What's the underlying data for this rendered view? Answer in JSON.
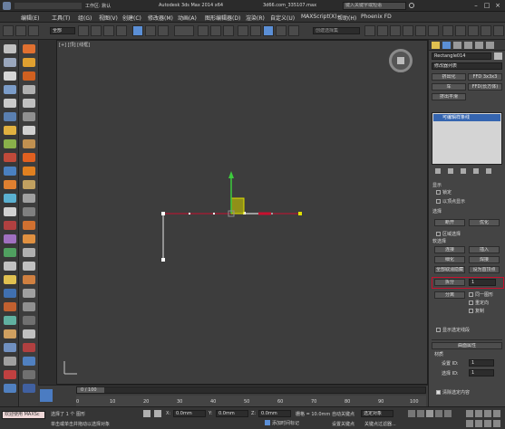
{
  "title": {
    "workspace_label": "工作区: 默认",
    "app_title": "Autodesk 3ds Max  2014 x64",
    "file_name": "3d66.com_335107.max",
    "search_placeholder": "键入关键字或短语"
  },
  "menu": [
    "编辑(E)",
    "工具(T)",
    "组(G)",
    "视图(V)",
    "创建(C)",
    "修改器(M)",
    "动画(A)",
    "图形编辑器(D)",
    "渲染(R)",
    "自定义(U)",
    "MAXScript(X)",
    "帮助(H)",
    "Phoenix FD"
  ],
  "toolbar": {
    "filter_value": "全部",
    "selection_set_placeholder": "创建选择集"
  },
  "viewport": {
    "label": "[+] [顶] [线框]"
  },
  "command_panel": {
    "object_name": "Rectangle014",
    "modifier_list": "修改器列表",
    "buttons_top": [
      "挤出化",
      "FFD 3x3x3",
      "车",
      "FFD(长方体)",
      "挤出平滑"
    ],
    "stack_item": "可编辑样条线",
    "section_labels": [
      "显示",
      "选择",
      "软选择"
    ],
    "checks": [
      "锁定",
      "以顶点显示",
      "区域选择"
    ],
    "buttons_mid": [
      "断开",
      "优化",
      "连接",
      "插入",
      "细化",
      "焊接",
      "全部取消隐藏",
      "设为首顶点"
    ],
    "divide_label": "拆分",
    "split_label": "分离",
    "divide_value": "1",
    "split_options": [
      "同一图形",
      "重定向",
      "复制"
    ],
    "radio_label": "显示选定线段",
    "surface_label": "曲面属性",
    "material_label": "材质",
    "set_id_label": "设置 ID:",
    "set_id_value": "1",
    "select_id_label": "选择 ID:",
    "select_id_value": "1",
    "clear_sel_label": "清除选定内容"
  },
  "timeline": {
    "frame_display": "0 / 100",
    "ticks": [
      "0",
      "10",
      "20",
      "30",
      "40",
      "50",
      "60",
      "70",
      "80",
      "90",
      "100"
    ]
  },
  "status": {
    "welcome": "欢迎使用 MAXSc",
    "selected": "选择了 1 个 图形",
    "hint": "单击或单击并拖动以选择对象",
    "x_label": "X:",
    "x_value": "0.0mm",
    "y_label": "Y:",
    "y_value": "0.0mm",
    "z_label": "Z:",
    "z_value": "0.0mm",
    "grid_label": "栅格 = 10.0mm",
    "auto_key": "自动关键点",
    "set_key": "设置关键点",
    "selected_obj": "选定对象",
    "key_filter": "关键点过滤器...",
    "add_time_tag": "添加时间标记"
  },
  "colors": {
    "selection_red": "#c8102e",
    "axis_yellow": "#e0e000",
    "gizmo_green": "#3dcc3d",
    "active_blue": "#5b8fd6"
  }
}
